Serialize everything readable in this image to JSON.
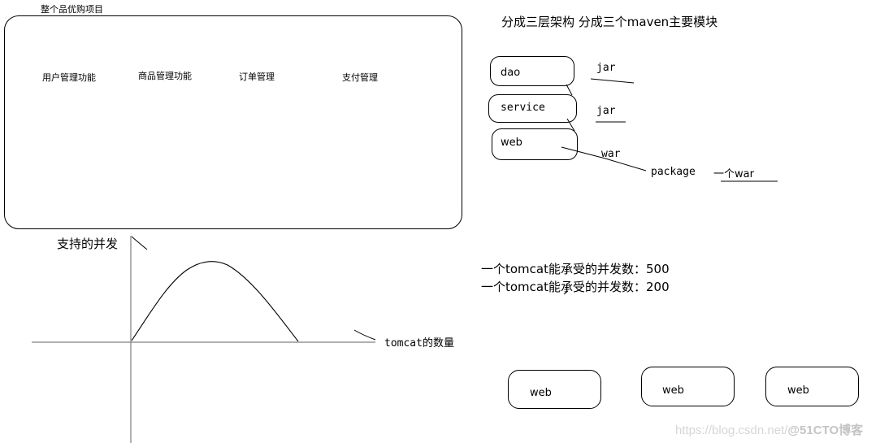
{
  "project": {
    "title": "整个品优购项目",
    "modules": [
      "用户管理功能",
      "商品管理功能",
      "订单管理",
      "支付管理"
    ]
  },
  "architecture": {
    "heading": "分成三层架构  分成三个maven主要模块",
    "layers": [
      {
        "name": "dao",
        "packaging": "jar"
      },
      {
        "name": "service",
        "packaging": "jar"
      },
      {
        "name": "web",
        "packaging": "war"
      }
    ],
    "package_label": "package",
    "package_result": "一个war"
  },
  "concurrency_graph": {
    "y_label": "支持的并发",
    "x_label": "tomcat的数量",
    "curve_shape": "rises to a peak then falls"
  },
  "notes": [
    "一个tomcat能承受的并发数：500",
    "一个tomcat能承受的并发数：200"
  ],
  "cluster": {
    "nodes": [
      "web",
      "web",
      "web"
    ]
  },
  "watermark": {
    "url": "https://blog.csdn.net/",
    "brand": "@51CTO博客"
  }
}
